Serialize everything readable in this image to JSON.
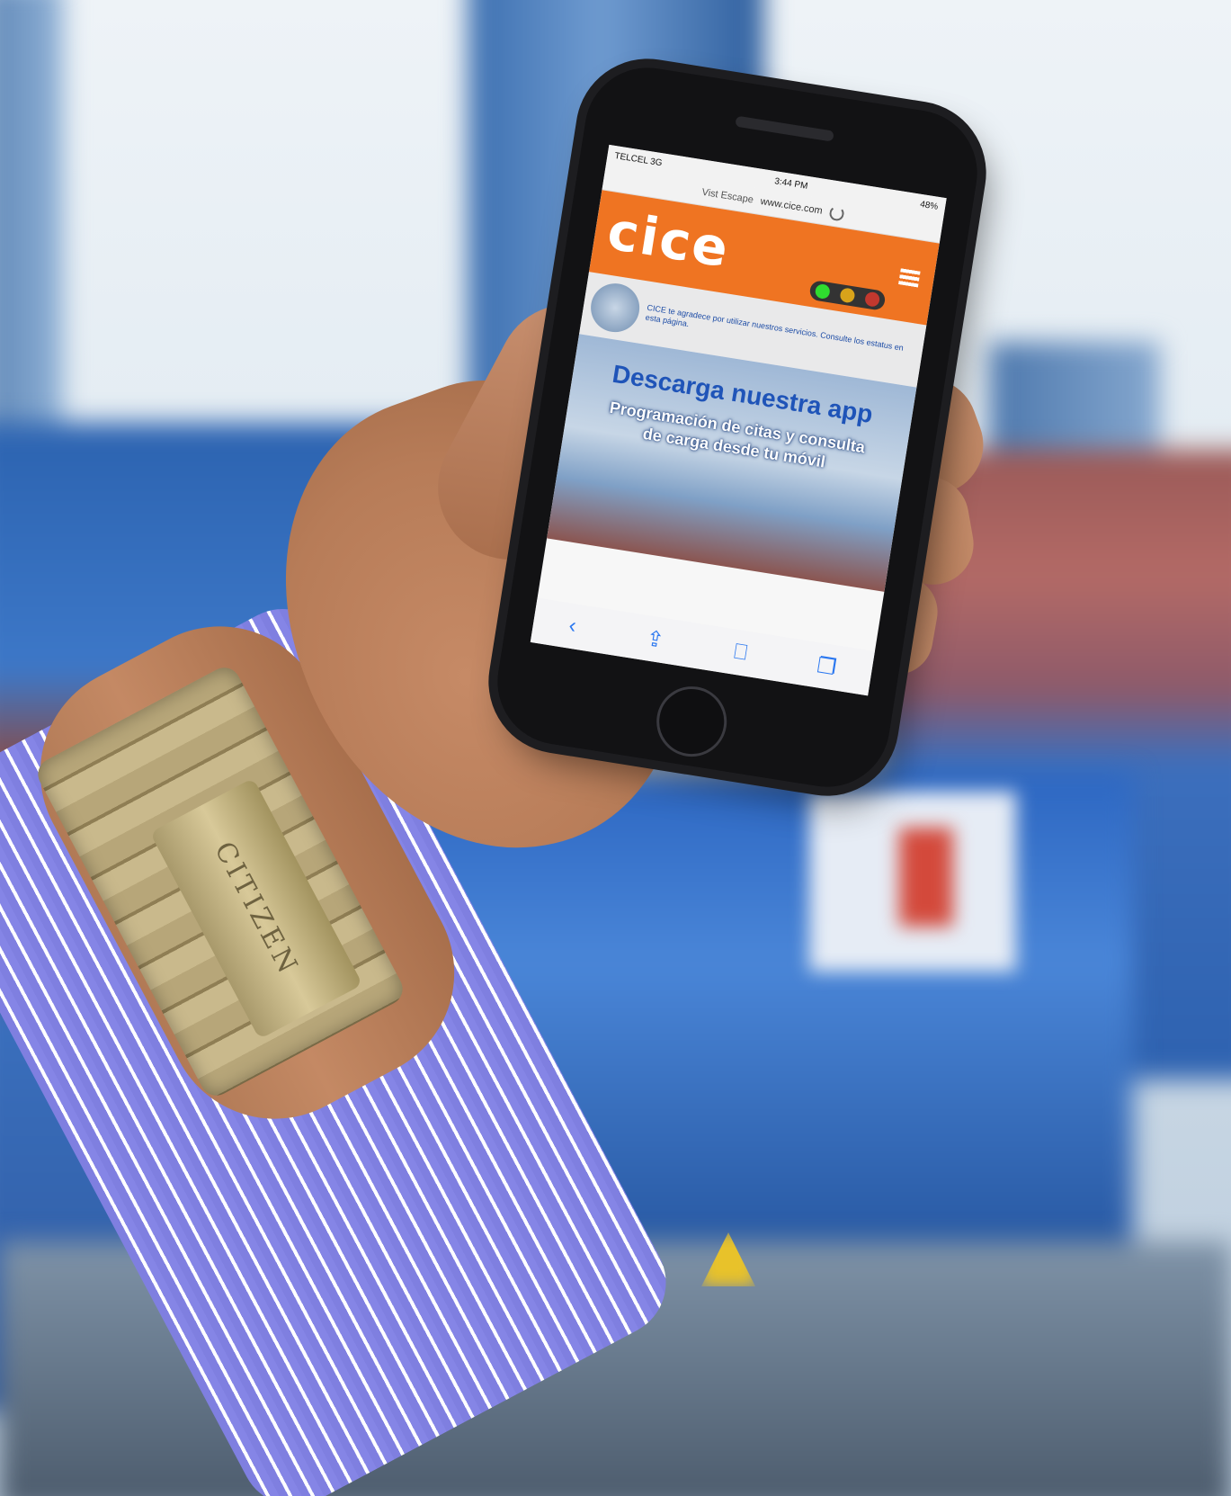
{
  "phone": {
    "status_bar": {
      "carrier": "TELCEL 3G",
      "time": "3:44 PM",
      "battery": "48%"
    },
    "url_bar": {
      "reader_label": "Vist Escape",
      "address": "www.cice.com"
    },
    "site": {
      "logo_text": "cice",
      "notice_text": "CICE te agradece por utilizar nuestros servicios. Consulte los estatus en esta página.",
      "banner_title": "Descarga nuestra app",
      "banner_subtitle": "Programación de citas y consulta de carga desde tu móvil",
      "traffic_light_colors": [
        "#2fdc2f",
        "#d8a31a",
        "#c2382e"
      ]
    },
    "toolbar": {
      "back_icon": "back-chevron-icon",
      "share_icon": "share-icon",
      "bookmarks_icon": "bookmarks-icon",
      "tabs_icon": "tabs-icon"
    }
  },
  "watch": {
    "brand": "CITIZEN"
  }
}
